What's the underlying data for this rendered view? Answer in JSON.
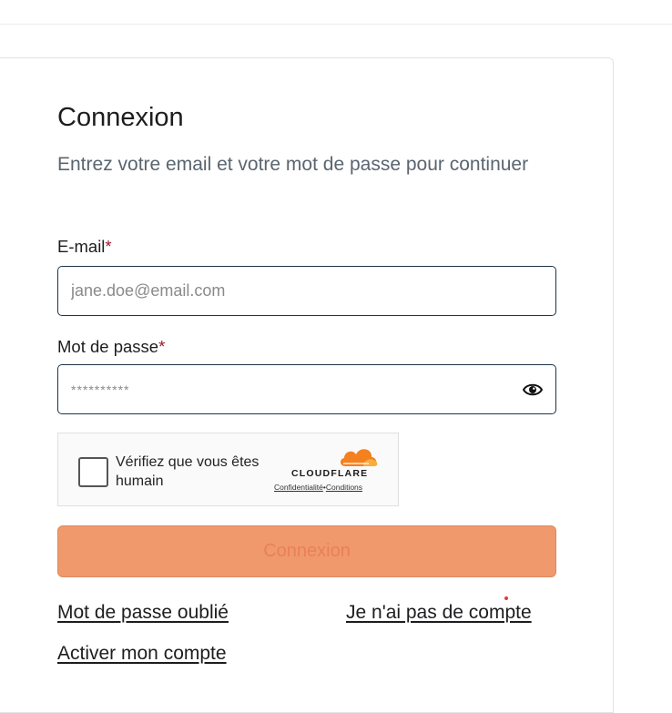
{
  "login": {
    "title": "Connexion",
    "subtitle": "Entrez votre email et votre mot de passe pour continuer",
    "email_label": "E-mail",
    "email_required_marker": "*",
    "email_placeholder": "jane.doe@email.com",
    "password_label": "Mot de passe",
    "password_required_marker": "*",
    "password_placeholder": "**********",
    "show_password_icon": "eye-icon",
    "submit_label": "Connexion",
    "forgot_password_link": "Mot de passe oublié",
    "no_account_link": "Je n'ai pas de compte",
    "activate_account_link": "Activer mon compte"
  },
  "captcha": {
    "text": "Vérifiez que vous êtes humain",
    "brand": "CLOUDFLARE",
    "privacy_link": "Confidentialité",
    "separator": "•",
    "terms_link": "Conditions",
    "logo_icon": "cloudflare-cloud-icon"
  },
  "colors": {
    "submit_background": "#f0996c",
    "required_marker": "#9b1c2b",
    "field_border": "#1f3447",
    "cloudflare_orange": "#f48120"
  }
}
